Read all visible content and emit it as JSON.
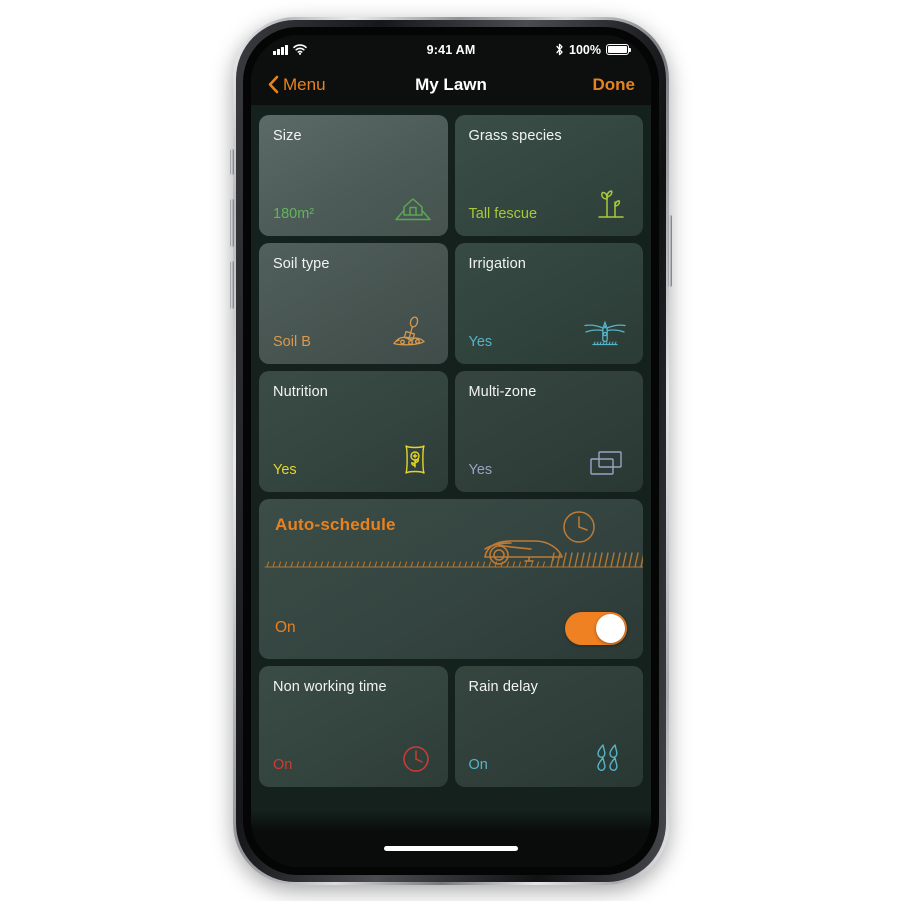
{
  "status_bar": {
    "time": "9:41 AM",
    "battery_percent": "100%",
    "signal_icon": "cellular-bars-icon",
    "wifi_icon": "wifi-icon",
    "bluetooth_icon": "bluetooth-icon",
    "battery_icon": "battery-full-icon"
  },
  "nav_bar": {
    "back_label": "Menu",
    "back_icon": "chevron-left-icon",
    "title": "My Lawn",
    "done_label": "Done"
  },
  "colors": {
    "accent_orange": "#e8821e",
    "toggle_on": "#ef8123",
    "screen_bg": "#14211d",
    "green": "#63b55c",
    "yellow_green": "#a8c83c",
    "tan": "#d89a4e",
    "cyan": "#56b4c8",
    "yellow": "#e3d52a",
    "lavender": "#9aa3c4",
    "red": "#cf3b35"
  },
  "cards": [
    {
      "title": "Size",
      "value": "180m²",
      "value_color": "#63b55c",
      "icon": "lawn-house-icon",
      "style": "cool"
    },
    {
      "title": "Grass species",
      "value": "Tall fescue",
      "value_color": "#a8c83c",
      "icon": "grass-sprout-icon",
      "style": "green"
    },
    {
      "title": "Soil type",
      "value": "Soil B",
      "value_color": "#d89a4e",
      "icon": "shovel-soil-icon",
      "style": "slate"
    },
    {
      "title": "Irrigation",
      "value": "Yes",
      "value_color": "#56b4c8",
      "icon": "sprinkler-icon",
      "style": "dkgreen"
    },
    {
      "title": "Nutrition",
      "value": "Yes",
      "value_color": "#e3d52a",
      "icon": "fertilizer-bag-icon",
      "style": "deep"
    },
    {
      "title": "Multi-zone",
      "value": "Yes",
      "value_color": "#9aa3c4",
      "icon": "overlapping-zones-icon",
      "style": "deep2"
    }
  ],
  "auto_schedule": {
    "title": "Auto-schedule",
    "value": "On",
    "toggle_state": "on",
    "mower_icon": "robot-mower-icon",
    "clock_icon": "clock-icon",
    "grass_icon": "grass-line-icon"
  },
  "cards_bottom": [
    {
      "title": "Non working time",
      "value": "On",
      "value_color": "#cf3b35",
      "icon": "clock-outline-icon",
      "style": "deep"
    },
    {
      "title": "Rain delay",
      "value": "On",
      "value_color": "#56b4c8",
      "icon": "raindrops-icon",
      "style": "deep2"
    }
  ]
}
